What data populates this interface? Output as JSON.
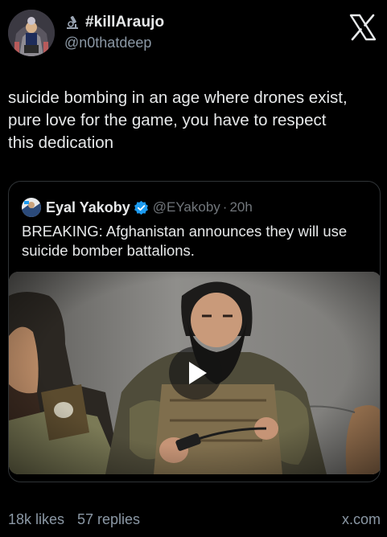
{
  "author": {
    "display_name": "#killAraujo",
    "handle": "@n0thatdeep"
  },
  "post": {
    "text": "suicide bombing in an age where drones exist,\npure love for the game, you have to respect\nthis dedication"
  },
  "quoted_post": {
    "display_name": "Eyal Yakoby",
    "handle": "@EYakoby",
    "separator": "·",
    "time": "20h",
    "text": "BREAKING: Afghanistan announces they will use suicide bomber battalions."
  },
  "footer": {
    "likes": "18k likes",
    "replies": "57 replies",
    "domain": "x.com"
  },
  "icons": {
    "brand_logo": "x-logo-icon",
    "verified": "verified-badge-icon",
    "play": "play-icon",
    "emoji": "microscope-emoji-icon"
  },
  "colors": {
    "background": "#000000",
    "text_primary": "#e7e9ea",
    "text_secondary": "#8b98a5",
    "border": "#2f3336",
    "verified_blue": "#1d9bf0"
  }
}
